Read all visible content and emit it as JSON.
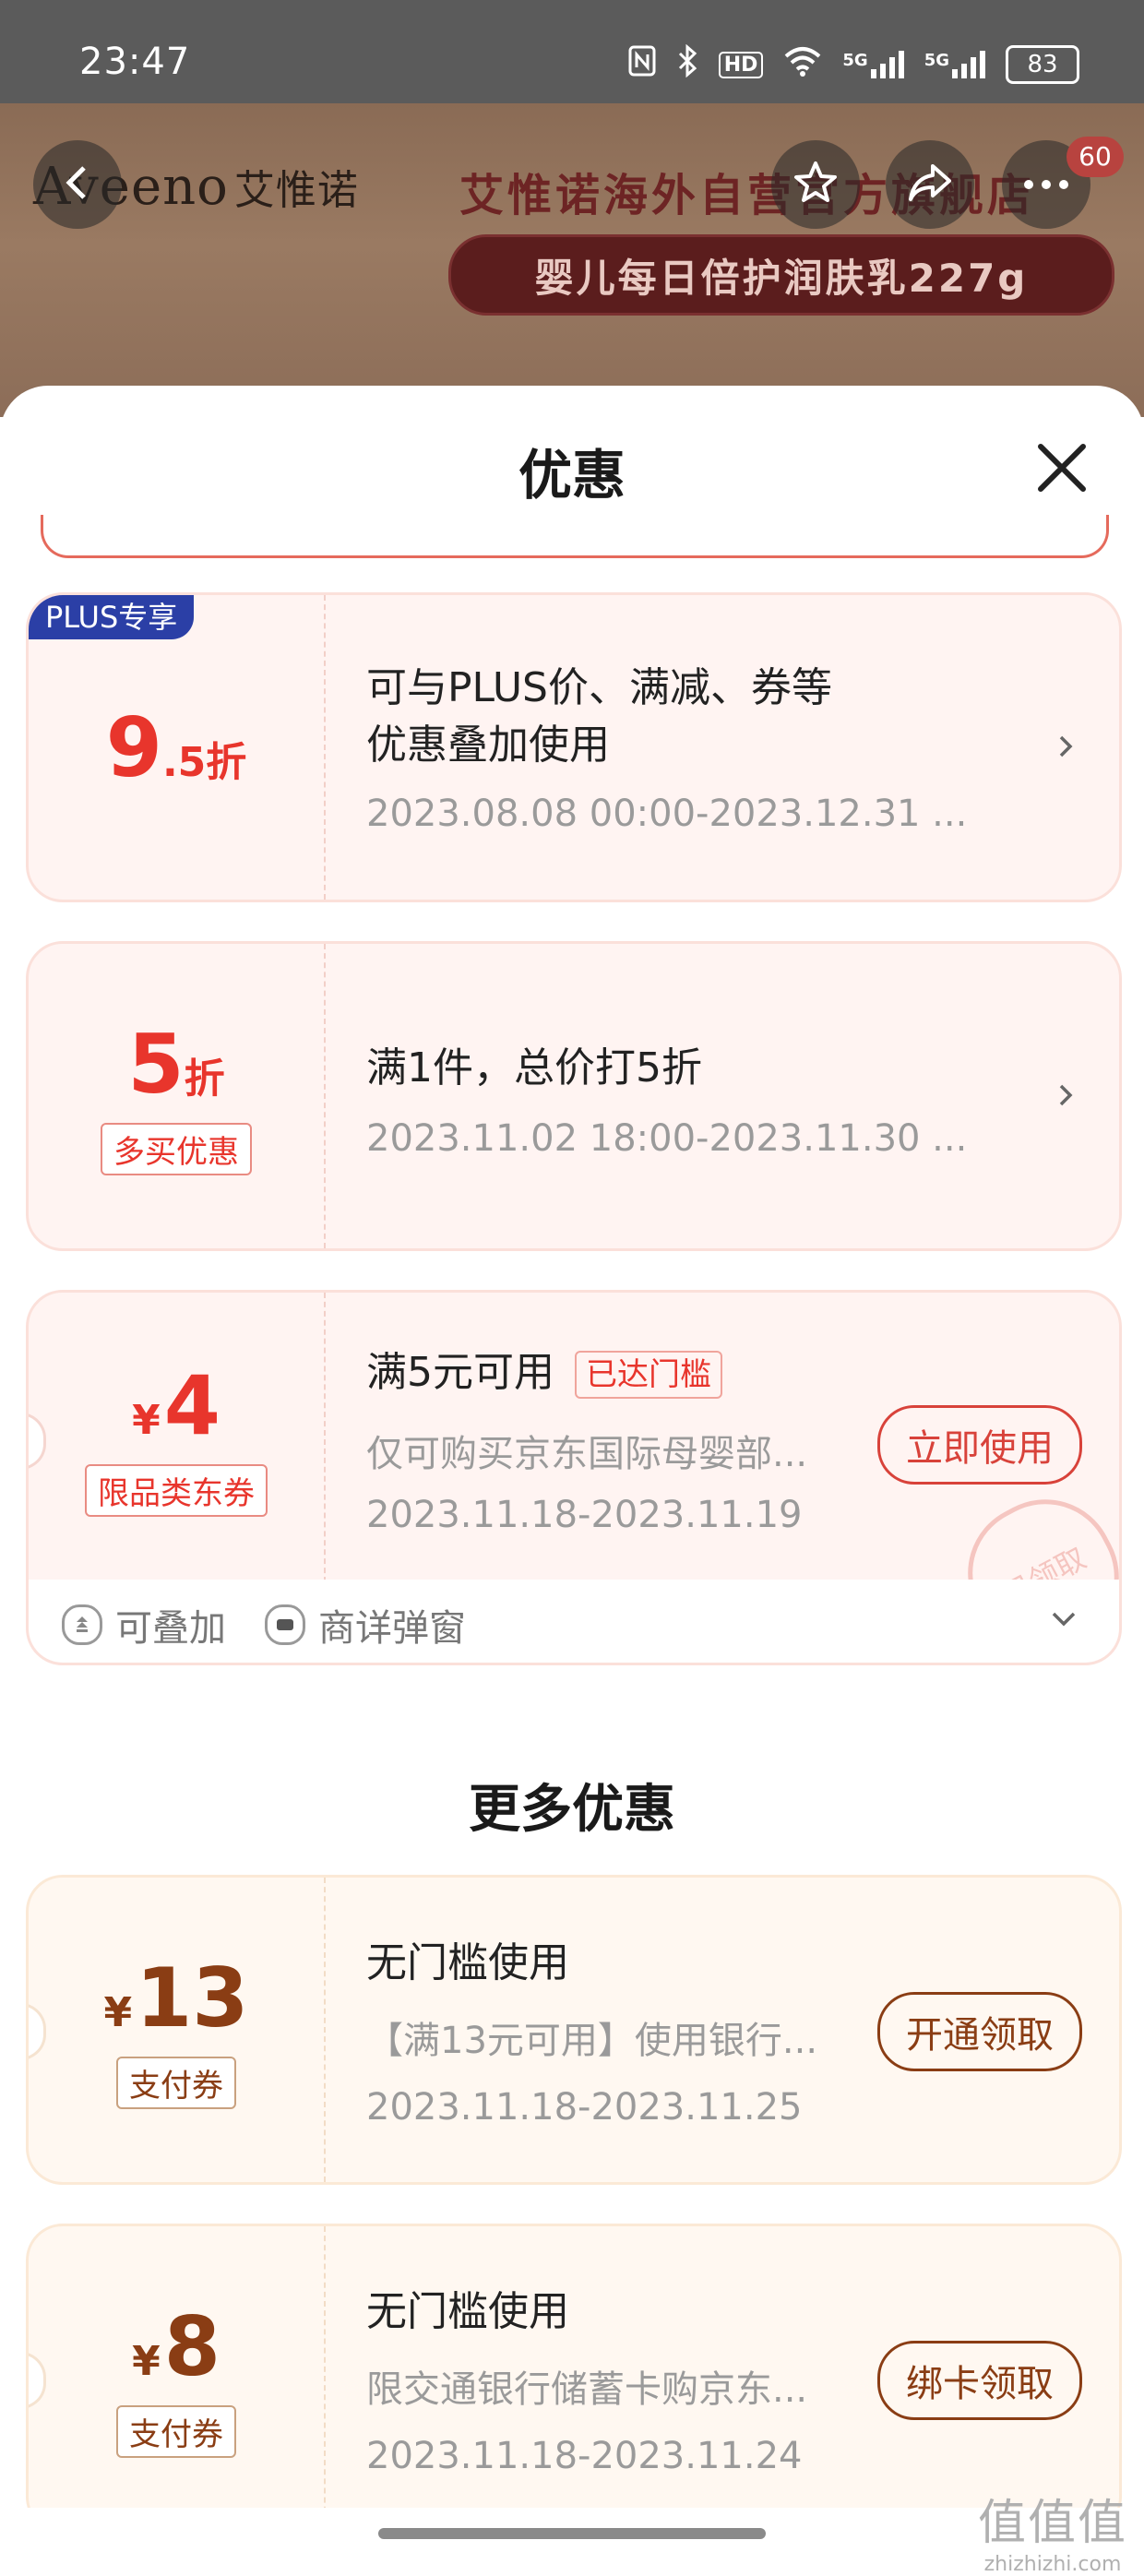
{
  "status_bar": {
    "time": "23:47",
    "icons": [
      "nfc-icon",
      "bluetooth-icon",
      "hd-icon",
      "wifi-icon",
      "signal-5g-icon",
      "signal-5g-icon"
    ],
    "hd_text": "HD",
    "net1": "5G",
    "net2": "5G",
    "battery": "83"
  },
  "background": {
    "brand_logo": "Aveeno",
    "brand_cn": "艾惟诺",
    "store_title": "艾惟诺海外自营官方旗舰店",
    "product_name": "婴儿每日倍护润肤乳227g",
    "badge_count": "60"
  },
  "sheet": {
    "title": "优惠"
  },
  "offers": [
    {
      "plus_badge": "PLUS专享",
      "amount_big": "9",
      "amount_small": ".5折",
      "title_line1": "可与PLUS价、满减、券等",
      "title_line2": "优惠叠加使用",
      "period": "2023.08.08 00:00-2023.12.31 ..."
    },
    {
      "amount_big": "5",
      "amount_small": "折",
      "tag": "多买优惠",
      "title": "满1件，总价打5折",
      "period": "2023.11.02 18:00-2023.11.30 ..."
    },
    {
      "currency": "¥",
      "amount_big": "4",
      "tag": "限品类东券",
      "title": "满5元可用",
      "status_tag": "已达门槛",
      "desc": "仅可购买京东国际母婴部...",
      "period": "2023.11.18-2023.11.19",
      "action": "立即使用",
      "stamp": "已领取",
      "footer": {
        "stackable": "可叠加",
        "popup": "商详弹窗"
      }
    }
  ],
  "more_section_title": "更多优惠",
  "more_offers": [
    {
      "currency": "¥",
      "amount_big": "13",
      "tag": "支付券",
      "title": "无门槛使用",
      "desc": "【满13元可用】使用银行...",
      "period": "2023.11.18-2023.11.25",
      "action": "开通领取"
    },
    {
      "currency": "¥",
      "amount_big": "8",
      "tag": "支付券",
      "title": "无门槛使用",
      "desc": "限交通银行储蓄卡购京东...",
      "period": "2023.11.18-2023.11.24",
      "action": "绑卡领取"
    }
  ],
  "watermark": {
    "line1": "值值值",
    "line2": "zhizhizhi.com"
  }
}
